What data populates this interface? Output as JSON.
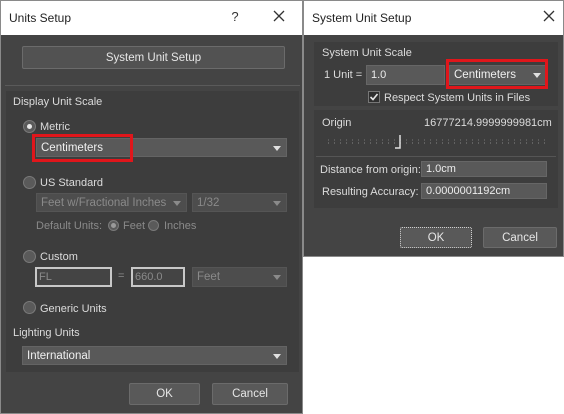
{
  "units_setup": {
    "title": "Units Setup",
    "help_glyph": "?",
    "system_unit_setup_button": "System Unit Setup",
    "display_unit_scale": {
      "label": "Display Unit Scale",
      "metric_label": "Metric",
      "metric_value": "Centimeters",
      "us_standard_label": "US Standard",
      "us_standard_value": "Feet w/Fractional Inches",
      "fraction_value": "1/32",
      "default_units_label": "Default Units:",
      "feet_label": "Feet",
      "inches_label": "Inches",
      "custom_label": "Custom",
      "custom_name_value": "FL",
      "equals": "=",
      "custom_amount_value": "660.0",
      "custom_unit_value": "Feet",
      "generic_units_label": "Generic Units",
      "selected": "Metric"
    },
    "lighting_units": {
      "label": "Lighting Units",
      "value": "International"
    },
    "ok_label": "OK",
    "cancel_label": "Cancel"
  },
  "system_unit_setup": {
    "title": "System Unit Setup",
    "system_unit_scale_label": "System Unit Scale",
    "one_unit_label": "1 Unit =",
    "one_unit_value": "1.0",
    "unit_value": "Centimeters",
    "respect_label": "Respect System Units in Files",
    "respect_checked": true,
    "origin_label": "Origin",
    "origin_value": "16777214.9999999981cm",
    "distance_label": "Distance from origin:",
    "distance_value": "1.0cm",
    "accuracy_label": "Resulting Accuracy:",
    "accuracy_value": "0.0000001192cm",
    "ok_label": "OK",
    "cancel_label": "Cancel"
  },
  "colors": {
    "dialog_bg": "#444444",
    "highlight": "#e0161b"
  },
  "icons": [
    "close-icon",
    "help-icon",
    "dropdown-arrow-icon",
    "checkmark-icon",
    "slider-thumb-icon"
  ]
}
